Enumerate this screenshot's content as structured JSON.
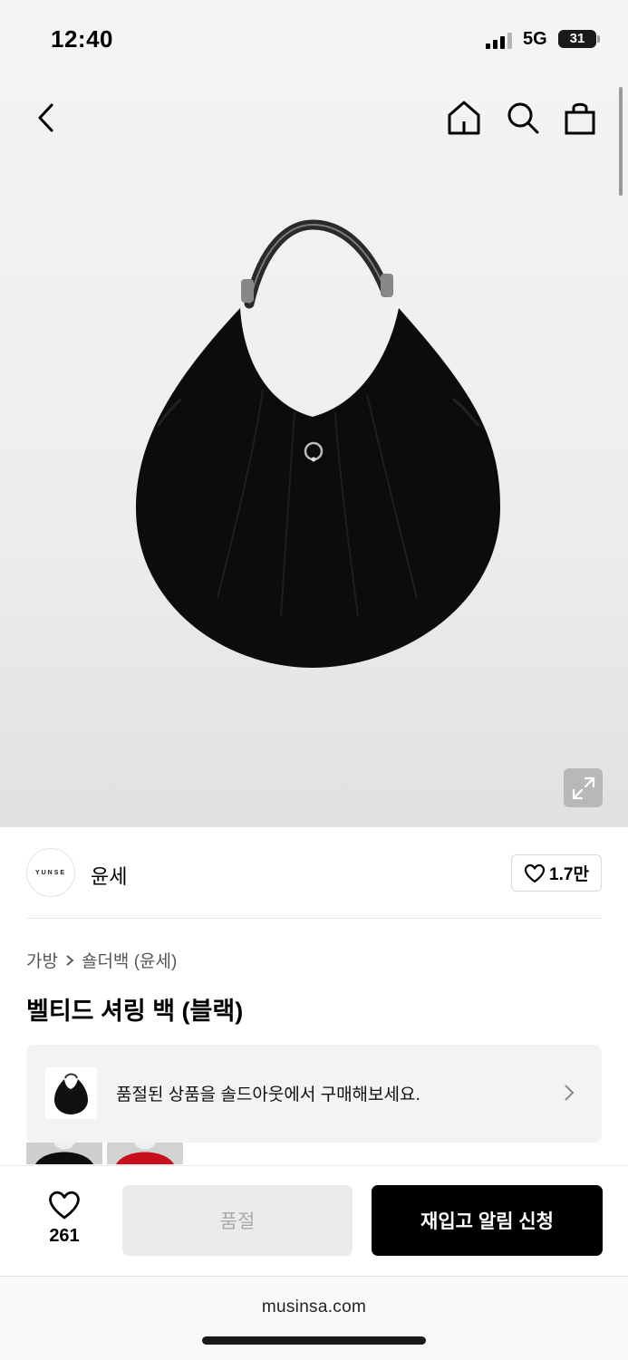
{
  "status_bar": {
    "time": "12:40",
    "network": "5G",
    "battery": "31"
  },
  "header": {
    "icons": [
      "back-icon",
      "home-icon",
      "search-icon",
      "bag-icon"
    ]
  },
  "hero": {
    "zoom_icon": "expand-icon"
  },
  "brand": {
    "logo_text": "YUNSE",
    "name": "윤세",
    "likes": "1.7만"
  },
  "breadcrumb": {
    "category": "가방",
    "subcategory": "숄더백 (윤세)"
  },
  "product": {
    "title": "벨티드 셔링 백 (블랙)"
  },
  "banner": {
    "text": "품절된 상품을 솔드아웃에서 구매해보세요."
  },
  "bottom_bar": {
    "like_count": "261",
    "soldout_label": "품절",
    "restock_label": "재입고 알림 신청"
  },
  "browser": {
    "url": "musinsa.com"
  }
}
